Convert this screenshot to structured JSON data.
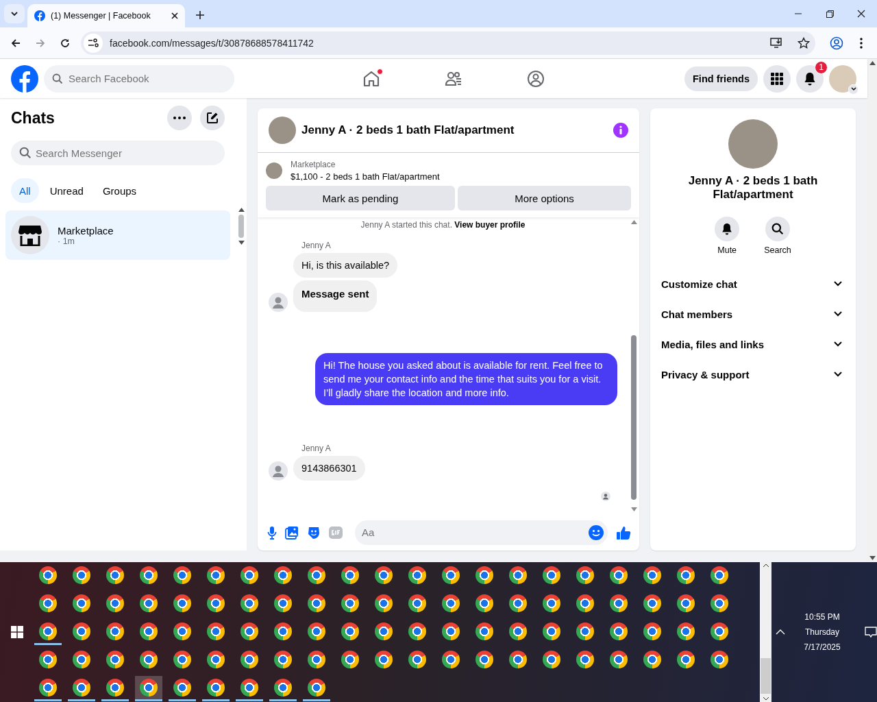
{
  "browser": {
    "tab": {
      "title": "(1) Messenger | Facebook"
    },
    "url": "facebook.com/messages/t/30878688578411742"
  },
  "header": {
    "search": {
      "placeholder": "Search Facebook"
    },
    "nav": [
      {
        "kind": "home",
        "dot": true
      },
      {
        "kind": "friends",
        "dot": false
      },
      {
        "kind": "groups",
        "dot": false
      }
    ],
    "find_friends": "Find friends",
    "notifications": {
      "count": "1"
    }
  },
  "chats": {
    "title": "Chats",
    "search": {
      "placeholder": "Search Messenger"
    },
    "filters": [
      {
        "label": "All",
        "selected": true
      },
      {
        "label": "Unread",
        "selected": false
      },
      {
        "label": "Groups",
        "selected": false
      }
    ],
    "items": [
      {
        "name": "Marketplace",
        "meta": "· 1m",
        "selected": true
      }
    ]
  },
  "conversation": {
    "title": "Jenny A · 2 beds 1 bath Flat/apartment",
    "listing": {
      "source": "Marketplace",
      "summary": "$1,100 - 2 beds 1 bath Flat/apartment"
    },
    "actions": [
      "Mark as pending",
      "More options"
    ],
    "notice": {
      "text": "Jenny A started this chat.",
      "link": "View buyer profile"
    },
    "messages": [
      {
        "kind": "incoming",
        "sender": "Jenny A",
        "bubbles": [
          {
            "text": "Hi, is this available?",
            "emphasis": false
          },
          {
            "text": "Message sent",
            "emphasis": true
          }
        ]
      },
      {
        "kind": "outgoing",
        "bubbles": [
          {
            "text": "Hi! The house you asked about is available for rent. Feel free to send me your contact info and the time that suits you for a visit. I’ll gladly share the location and more info.",
            "emphasis": false
          }
        ]
      },
      {
        "kind": "incoming",
        "sender": "Jenny A",
        "bubbles": [
          {
            "text": "9143866301",
            "emphasis": false
          }
        ]
      }
    ],
    "composer": {
      "placeholder": "Aa"
    }
  },
  "details": {
    "name": "Jenny A · 2 beds 1 bath Flat/apartment",
    "actions": [
      {
        "kind": "mute",
        "label": "Mute"
      },
      {
        "kind": "search",
        "label": "Search"
      }
    ],
    "sections": [
      {
        "label": "Customize chat",
        "expanded": false
      },
      {
        "label": "Chat members",
        "expanded": false
      },
      {
        "label": "Media, files and links",
        "expanded": false
      },
      {
        "label": "Privacy & support",
        "expanded": false
      }
    ]
  },
  "taskbar": {
    "icons": [
      {
        "running": false,
        "active": false
      },
      {
        "running": false,
        "active": false
      },
      {
        "running": false,
        "active": false
      },
      {
        "running": false,
        "active": false
      },
      {
        "running": false,
        "active": false
      },
      {
        "running": false,
        "active": false
      },
      {
        "running": false,
        "active": false
      },
      {
        "running": false,
        "active": false
      },
      {
        "running": false,
        "active": false
      },
      {
        "running": false,
        "active": false
      },
      {
        "running": false,
        "active": false
      },
      {
        "running": false,
        "active": false
      },
      {
        "running": false,
        "active": false
      },
      {
        "running": false,
        "active": false
      },
      {
        "running": false,
        "active": false
      },
      {
        "running": false,
        "active": false
      },
      {
        "running": false,
        "active": false
      },
      {
        "running": false,
        "active": false
      },
      {
        "running": false,
        "active": false
      },
      {
        "running": false,
        "active": false
      },
      {
        "running": false,
        "active": false
      },
      {
        "running": false,
        "active": false
      },
      {
        "running": false,
        "active": false
      },
      {
        "running": false,
        "active": false
      },
      {
        "running": false,
        "active": false
      },
      {
        "running": false,
        "active": false
      },
      {
        "running": false,
        "active": false
      },
      {
        "running": false,
        "active": false
      },
      {
        "running": false,
        "active": false
      },
      {
        "running": false,
        "active": false
      },
      {
        "running": false,
        "active": false
      },
      {
        "running": false,
        "active": false
      },
      {
        "running": false,
        "active": false
      },
      {
        "running": false,
        "active": false
      },
      {
        "running": false,
        "active": false
      },
      {
        "running": false,
        "active": false
      },
      {
        "running": false,
        "active": false
      },
      {
        "running": false,
        "active": false
      },
      {
        "running": false,
        "active": false
      },
      {
        "running": false,
        "active": false
      },
      {
        "running": false,
        "active": false
      },
      {
        "running": false,
        "active": false
      },
      {
        "running": true,
        "active": false
      },
      {
        "running": false,
        "active": false
      },
      {
        "running": false,
        "active": false
      },
      {
        "running": false,
        "active": false
      },
      {
        "running": false,
        "active": false
      },
      {
        "running": false,
        "active": false
      },
      {
        "running": false,
        "active": false
      },
      {
        "running": false,
        "active": false
      },
      {
        "running": false,
        "active": false
      },
      {
        "running": false,
        "active": false
      },
      {
        "running": false,
        "active": false
      },
      {
        "running": false,
        "active": false
      },
      {
        "running": false,
        "active": false
      },
      {
        "running": false,
        "active": false
      },
      {
        "running": false,
        "active": false
      },
      {
        "running": false,
        "active": false
      },
      {
        "running": false,
        "active": false
      },
      {
        "running": false,
        "active": false
      },
      {
        "running": false,
        "active": false
      },
      {
        "running": false,
        "active": false
      },
      {
        "running": false,
        "active": false
      },
      {
        "running": false,
        "active": false
      },
      {
        "running": false,
        "active": false
      },
      {
        "running": false,
        "active": false
      },
      {
        "running": false,
        "active": false
      },
      {
        "running": false,
        "active": false
      },
      {
        "running": false,
        "active": false
      },
      {
        "running": false,
        "active": false
      },
      {
        "running": false,
        "active": false
      },
      {
        "running": false,
        "active": false
      },
      {
        "running": false,
        "active": false
      },
      {
        "running": false,
        "active": false
      },
      {
        "running": false,
        "active": false
      },
      {
        "running": false,
        "active": false
      },
      {
        "running": false,
        "active": false
      },
      {
        "running": false,
        "active": false
      },
      {
        "running": false,
        "active": false
      },
      {
        "running": false,
        "active": false
      },
      {
        "running": false,
        "active": false
      },
      {
        "running": false,
        "active": false
      },
      {
        "running": false,
        "active": false
      },
      {
        "running": false,
        "active": false
      },
      {
        "running": true,
        "active": false
      },
      {
        "running": true,
        "active": false
      },
      {
        "running": true,
        "active": false
      },
      {
        "running": true,
        "active": true
      },
      {
        "running": true,
        "active": false
      },
      {
        "running": true,
        "active": false
      },
      {
        "running": true,
        "active": false
      },
      {
        "running": true,
        "active": false
      },
      {
        "running": true,
        "active": false
      }
    ],
    "clock": {
      "time": "10:55 PM",
      "day": "Thursday",
      "date": "7/17/2025"
    }
  }
}
